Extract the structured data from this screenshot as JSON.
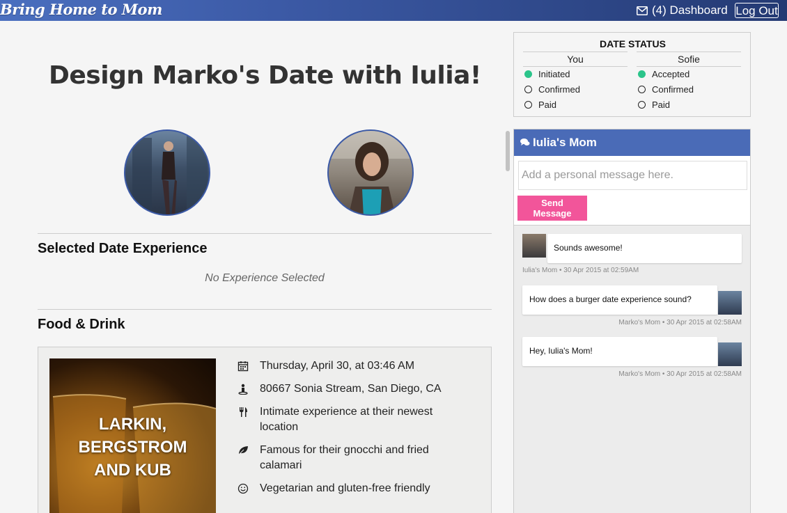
{
  "app": {
    "brand": "Bring Home to Mom"
  },
  "nav": {
    "dashboard_label": "(4) Dashboard",
    "logout_label": "Log Out"
  },
  "main": {
    "title": "Design Marko's Date with Iulia!",
    "selected_section_title": "Selected Date Experience",
    "no_experience_text": "No Experience Selected",
    "food_section_title": "Food & Drink",
    "experience": {
      "name": "LARKIN,\nBERGSTROM\nAND KUB",
      "details": [
        {
          "icon": "calendar-icon",
          "text": "Thursday, April 30, at 03:46 AM"
        },
        {
          "icon": "location-person-icon",
          "text": "80667 Sonia Stream, San Diego, CA"
        },
        {
          "icon": "utensils-icon",
          "text": "Intimate experience at their newest location"
        },
        {
          "icon": "leaf-icon",
          "text": "Famous for their gnocchi and fried calamari"
        },
        {
          "icon": "smile-icon",
          "text": "Vegetarian and gluten-free friendly"
        }
      ]
    }
  },
  "date_status": {
    "title": "DATE STATUS",
    "columns": [
      {
        "heading": "You",
        "items": [
          {
            "label": "Initiated",
            "done": true
          },
          {
            "label": "Confirmed",
            "done": false
          },
          {
            "label": "Paid",
            "done": false
          }
        ]
      },
      {
        "heading": "Sofie",
        "items": [
          {
            "label": "Accepted",
            "done": true
          },
          {
            "label": "Confirmed",
            "done": false
          },
          {
            "label": "Paid",
            "done": false
          }
        ]
      }
    ],
    "done_color": "#2bc48a"
  },
  "chat": {
    "title": "Iulia's Mom",
    "input_placeholder": "Add a personal message here.",
    "send_label": "Send Message",
    "messages": [
      {
        "text": "Sounds awesome!",
        "meta": "Iulia's Mom • 30 Apr 2015 at 02:59AM"
      },
      {
        "text": "How does a burger date experience sound?",
        "meta": "Marko's Mom • 30 Apr 2015 at 02:58AM"
      },
      {
        "text": "Hey, Iulia's Mom!",
        "meta": "Marko's Mom • 30 Apr 2015 at 02:58AM"
      }
    ]
  },
  "colors": {
    "brand_blue": "#4a6bb7",
    "send_pink": "#f2559a"
  }
}
